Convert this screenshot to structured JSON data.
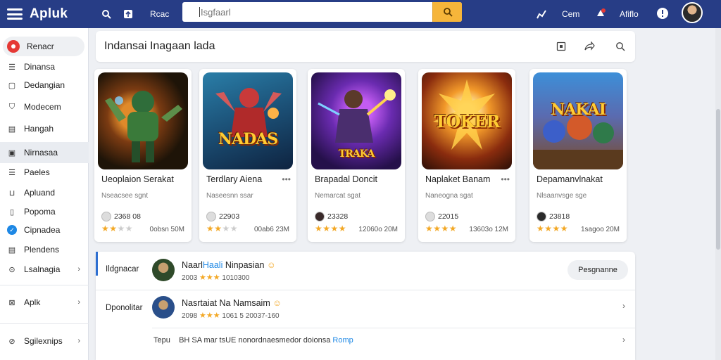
{
  "app": {
    "title": "Apluk"
  },
  "topbar": {
    "nav_label": "Rcac",
    "search_placeholder": "Isgfaarl",
    "link_1": "Cem",
    "link_2": "Afiflo"
  },
  "sidebar": {
    "items": [
      {
        "label": "Renacr",
        "icon": "record-icon"
      },
      {
        "label": "Dinansa",
        "icon": "list-icon"
      },
      {
        "label": "Dedangian",
        "icon": "square-icon"
      },
      {
        "label": "Modecem",
        "icon": "shield-icon"
      },
      {
        "label": "Hangah",
        "icon": "grid-icon"
      },
      {
        "label": "Nirnasaa",
        "icon": "photo-icon"
      },
      {
        "label": "Paeles",
        "icon": "list-icon"
      },
      {
        "label": "Apluand",
        "icon": "bag-icon"
      },
      {
        "label": "Popoma",
        "icon": "book-icon"
      },
      {
        "label": "Cipnadea",
        "icon": "check-icon"
      },
      {
        "label": "Plendens",
        "icon": "grid-icon"
      },
      {
        "label": "Lsalnagia",
        "icon": "gear-icon"
      },
      {
        "label": "Aplk",
        "icon": "image-icon"
      },
      {
        "label": "Sgilexnips",
        "icon": "settings-icon"
      }
    ]
  },
  "section": {
    "title": "Indansai Inagaan lada"
  },
  "cards": [
    {
      "name": "Ueoplaion Serakat",
      "subtitle": "Nseacsee sgnt",
      "ratings": "2368 08",
      "stars": 2.5,
      "size": "0obsn 50M",
      "logo": ""
    },
    {
      "name": "Terdlary Aiena",
      "subtitle": "Naseesnn ssar",
      "ratings": "22903",
      "stars": 2.5,
      "size": "00ab6 23M",
      "logo": "NADAS"
    },
    {
      "name": "Brapadal Doncit",
      "subtitle": "Nemarcat sgat",
      "ratings": "23328",
      "stars": 4,
      "size": "12060o 20M",
      "logo": "TRAKA"
    },
    {
      "name": "Naplaket Banam",
      "subtitle": "Naneogna sgat",
      "ratings": "22015",
      "stars": 4,
      "size": "13603o 12M",
      "logo": "TOKER"
    },
    {
      "name": "Depamanvlnakat",
      "subtitle": "Nlsaanvsge sge",
      "ratings": "23818",
      "stars": 4,
      "size": "1sagoo 20M",
      "logo": "NAKAI"
    }
  ],
  "reviews": {
    "items": [
      {
        "label": "Ildgnacar",
        "name_a": "Naarl",
        "name_b": "Haali",
        "name_c": "Ninpasian",
        "meta_count": "2003",
        "meta_text": "1010300",
        "stars": 3
      },
      {
        "label": "Dponolitar",
        "name_a": "Nasrtaiat Na Namsaim",
        "meta_count": "2098",
        "meta_text": "1061 5 20037-160",
        "stars": 3
      }
    ],
    "button_label": "Pesgnanne",
    "footer_prefix": "Tepu",
    "footer_text": "BH SA mar tsUE nonordnaesmedor doionsa",
    "footer_link": "Romp"
  },
  "colors": {
    "topbar": "#273d86",
    "accent": "#f6b53a",
    "star": "#f3a825",
    "link": "#1e88e5"
  }
}
